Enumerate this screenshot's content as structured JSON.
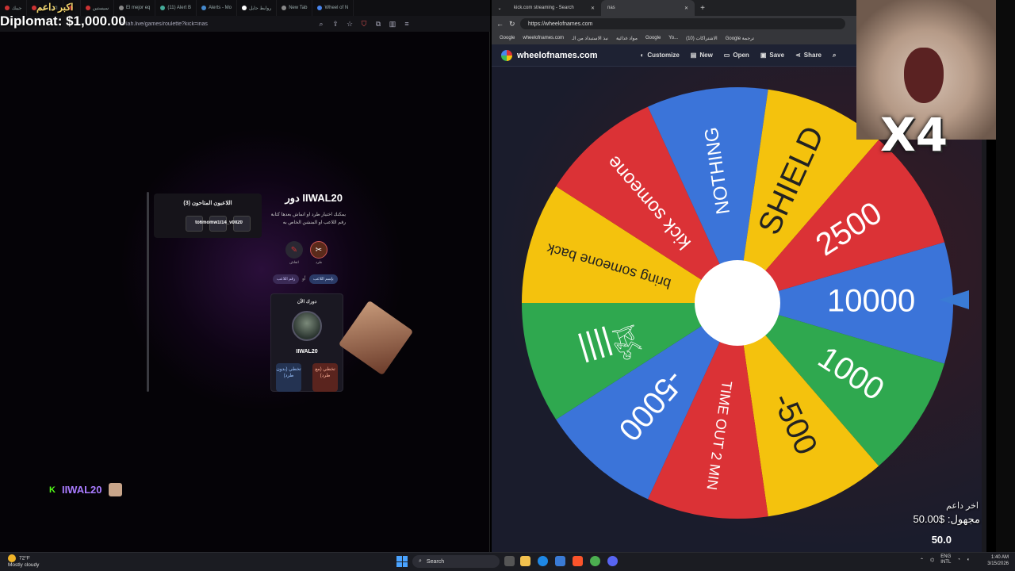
{
  "left_browser": {
    "tabs": [
      "جيبك",
      "اكبر داعم",
      "",
      "سيستين",
      "El mejor eq",
      "(11) Alert B",
      "Alerts - Mo",
      "روابط حايل",
      "New Tab",
      "Wheel of N"
    ],
    "url": "twlah.live/games/roulette?kick=inas"
  },
  "overlay": {
    "diplomat": "Diplomat: $1,000.00",
    "top_supporter": "اكبر داعم"
  },
  "game": {
    "players_title": "اللاعبون المتاحون (3)",
    "players_names": "to6momw1l14_v0ll20",
    "turn_title": "دور IIWAL20",
    "turn_desc": "يمكنك اختيار طرد او انماش بعدها كتابة رقم اللاعب او المنشن الخاص به",
    "action_kick_label": "طرد",
    "action_revive_label": "انعاش",
    "pill_mention": "بإسم اللاعب",
    "pill_or": "أو",
    "pill_number": "رقم اللاعب",
    "card_title": "دورك الآن",
    "card_name": "IIWAL20",
    "btn_skip_no_kick": "تخطي (بدون طرد)",
    "btn_skip_with_kick": "تخطي (مع طرد)"
  },
  "streamer": {
    "platform_icon": "kick-logo-icon",
    "name": "IIWAL20"
  },
  "right_browser": {
    "tabs": [
      "kick.com streaming - Search",
      "nas"
    ],
    "url": "https://wheelofnames.com",
    "bookmarks": [
      "Google",
      "wheelofnames.com",
      "نبذ الاستبداد من الـ",
      "مواد غذائية",
      "Google",
      "Yo...",
      "(10) الاشتراكات",
      "Google ترجمة"
    ]
  },
  "wheelofnames": {
    "brand": "wheelofnames.com",
    "menu": [
      "Customize",
      "New",
      "Open",
      "Save",
      "Share"
    ],
    "segments": [
      {
        "label": "10000",
        "color": "#3b74d9"
      },
      {
        "label": "1000",
        "color": "#2fa84f"
      },
      {
        "label": "-500",
        "color": "#f4c20d"
      },
      {
        "label": "TIME OUT 2 MIN",
        "color": "#db3236"
      },
      {
        "label": "-5000",
        "color": "#3b74d9"
      },
      {
        "label": "𓀀||||",
        "color": "#2fa84f"
      },
      {
        "label": "bring someone back",
        "color": "#f4c20d"
      },
      {
        "label": "kick someone",
        "color": "#db3236"
      },
      {
        "label": "NOTHING",
        "color": "#3b74d9"
      },
      {
        "label": "SHIELD",
        "color": "#f4c20d"
      },
      {
        "label": "2500",
        "color": "#db3236"
      }
    ]
  },
  "webcam": {
    "multiplier": "X4"
  },
  "donation": {
    "title": "اخر داعم",
    "amount": "مجهول: $50.00",
    "counter": "50.0"
  },
  "taskbar": {
    "weather_temp": "72°F",
    "weather_desc": "Mostly cloudy",
    "search_placeholder": "Search",
    "lang": "ENG",
    "lang_sub": "INTL",
    "time": "1:40 AM",
    "date": "3/15/2026"
  }
}
